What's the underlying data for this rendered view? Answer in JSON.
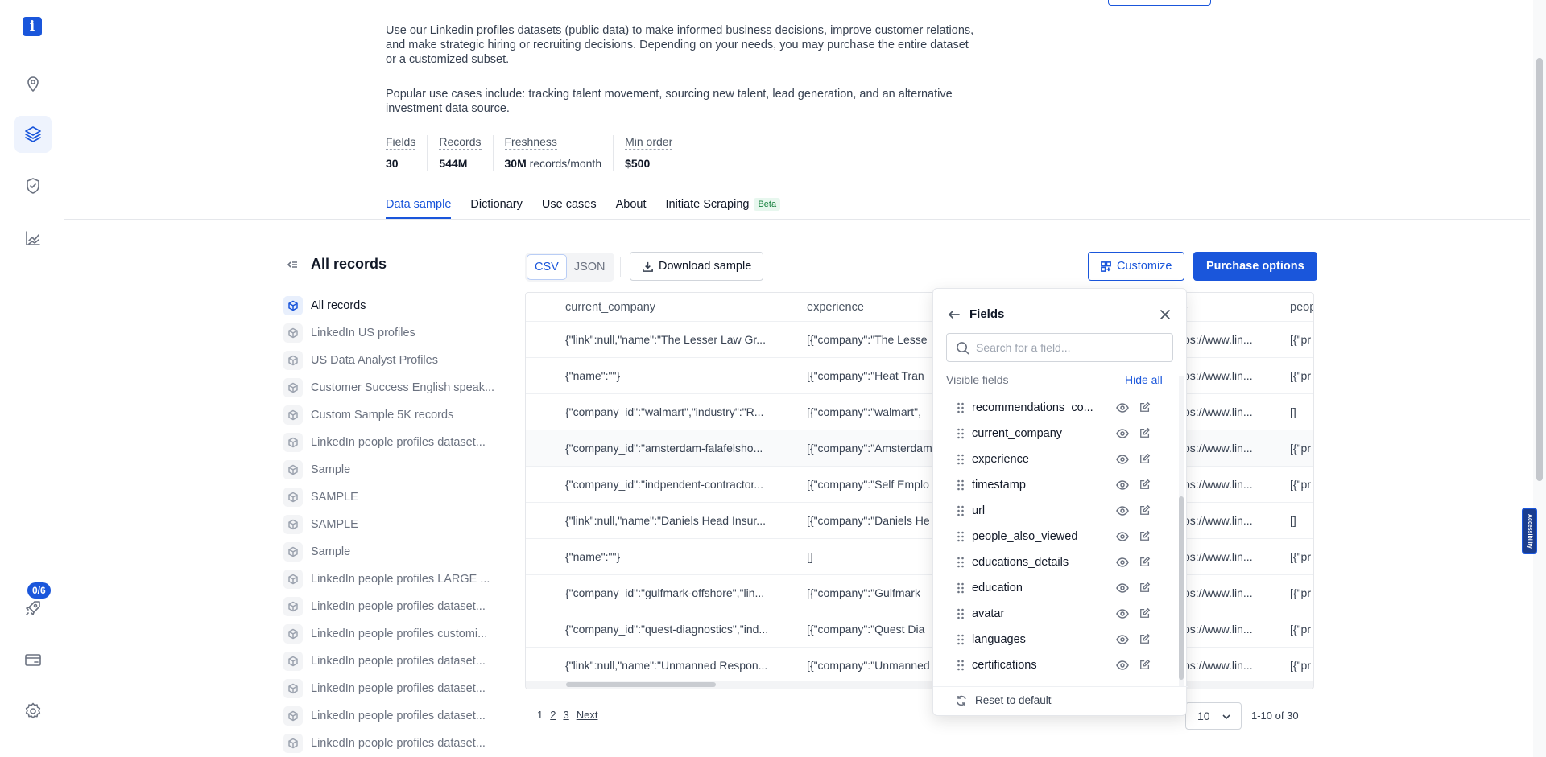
{
  "description": {
    "paragraph1": "Use our Linkedin profiles datasets (public data) to make informed business decisions, improve customer relations, and make strategic hiring or recruiting decisions. Depending on your needs, you may purchase the entire dataset or a customized subset.",
    "paragraph2": "Popular use cases include: tracking talent movement, sourcing new talent, lead generation, and an alternative investment data source."
  },
  "stats": [
    {
      "label": "Fields",
      "value": "30",
      "unit": ""
    },
    {
      "label": "Records",
      "value": "544M",
      "unit": ""
    },
    {
      "label": "Freshness",
      "value": "30M",
      "unit": "records/month"
    },
    {
      "label": "Min order",
      "value": "$500",
      "unit": ""
    }
  ],
  "tabs": [
    {
      "label": "Data sample",
      "active": true
    },
    {
      "label": "Dictionary"
    },
    {
      "label": "Use cases"
    },
    {
      "label": "About"
    },
    {
      "label": "Initiate Scraping",
      "badge": "Beta"
    }
  ],
  "sidebar": {
    "badge": "0/6",
    "logo": "i"
  },
  "records": {
    "title": "All records",
    "items": [
      "All records",
      "LinkedIn US profiles",
      "US Data Analyst Profiles",
      "Customer Success English speak...",
      "Custom Sample 5K records",
      "LinkedIn people profiles dataset...",
      "Sample",
      "SAMPLE",
      "SAMPLE",
      "Sample",
      "LinkedIn people profiles LARGE ...",
      "LinkedIn people profiles dataset...",
      "LinkedIn people profiles customi...",
      "LinkedIn people profiles dataset...",
      "LinkedIn people profiles dataset...",
      "LinkedIn people profiles dataset...",
      "LinkedIn people profiles dataset..."
    ]
  },
  "toolbar": {
    "format_csv": "CSV",
    "format_json": "JSON",
    "download": "Download sample",
    "customize": "Customize",
    "purchase": "Purchase options"
  },
  "table": {
    "headers": [
      "current_company",
      "experience",
      "-",
      "peop"
    ],
    "rows": [
      [
        "{\"link\":null,\"name\":\"The Lesser Law Gr...",
        "[{\"company\":\"The Lesse",
        "ps://www.lin...",
        "[{\"pr"
      ],
      [
        "{\"name\":\"\"}",
        "[{\"company\":\"Heat Tran",
        "ps://www.lin...",
        "[{\"pr"
      ],
      [
        "{\"company_id\":\"walmart\",\"industry\":\"R...",
        "[{\"company\":\"walmart\",",
        "ps://www.lin...",
        "[]"
      ],
      [
        "{\"company_id\":\"amsterdam-falafelsho...",
        "[{\"company\":\"Amsterdam",
        "ps://www.lin...",
        "[{\"pr"
      ],
      [
        "{\"company_id\":\"indpendent-contractor...",
        "[{\"company\":\"Self Emplo",
        "ps://www.lin...",
        "[{\"pr"
      ],
      [
        "{\"link\":null,\"name\":\"Daniels Head Insur...",
        "[{\"company\":\"Daniels He",
        "ps://www.lin...",
        "[]"
      ],
      [
        "{\"name\":\"\"}",
        "[]",
        "ps://www.lin...",
        "[{\"pr"
      ],
      [
        "{\"company_id\":\"gulfmark-offshore\",\"lin...",
        "[{\"company\":\"Gulfmark",
        "ps://www.lin...",
        "[{\"pr"
      ],
      [
        "{\"company_id\":\"quest-diagnostics\",\"ind...",
        "[{\"company\":\"Quest Dia",
        "ps://www.lin...",
        "[{\"pr"
      ],
      [
        "{\"link\":null,\"name\":\"Unmanned Respon...",
        "[{\"company\":\"Unmanned",
        "ps://www.lin...",
        "[{\"pr"
      ]
    ]
  },
  "pagination": {
    "pages": [
      "1",
      "2",
      "3"
    ],
    "next": "Next",
    "per_page": "10",
    "range": "1-10 of 30"
  },
  "fields_panel": {
    "title": "Fields",
    "search_placeholder": "Search for a field...",
    "visible_label": "Visible fields",
    "hide_all": "Hide all",
    "fields": [
      "recommendations_co...",
      "current_company",
      "experience",
      "timestamp",
      "url",
      "people_also_viewed",
      "educations_details",
      "education",
      "avatar",
      "languages",
      "certifications"
    ],
    "reset": "Reset to default"
  },
  "accessibility_label": "Accessibility",
  "colors": {
    "accent": "#1a56db",
    "beta_bg": "#e7f7ee",
    "beta_text": "#15803d"
  }
}
